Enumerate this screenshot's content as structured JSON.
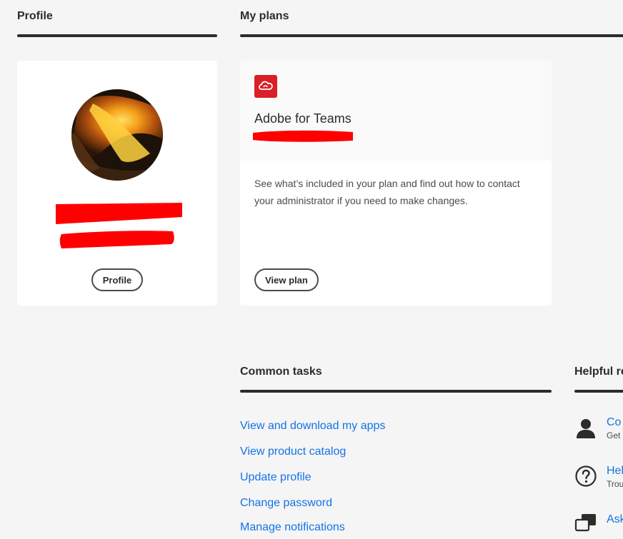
{
  "profile": {
    "section_title": "Profile",
    "button_label": "Profile"
  },
  "plans": {
    "section_title": "My plans",
    "plan_name": "Adobe for Teams",
    "plan_icon": "creative-cloud-icon",
    "description": "See what’s included in your plan and find out how to contact your administrator if you need to make changes.",
    "button_label": "View plan"
  },
  "common_tasks": {
    "section_title": "Common tasks",
    "links": [
      "View and download my apps",
      "View product catalog",
      "Update profile",
      "Change password",
      "Manage notifications"
    ]
  },
  "helpful": {
    "section_title": "Helpful re",
    "items": [
      {
        "icon": "person-icon",
        "title": "Co",
        "subtitle": "Get"
      },
      {
        "icon": "question-icon",
        "title": "Hel",
        "subtitle": "Trou"
      },
      {
        "icon": "chat-icon",
        "title": "Ask",
        "subtitle": ""
      }
    ]
  },
  "colors": {
    "link": "#1473e6",
    "redaction": "#ff0000",
    "cc_red": "#da1f26"
  }
}
